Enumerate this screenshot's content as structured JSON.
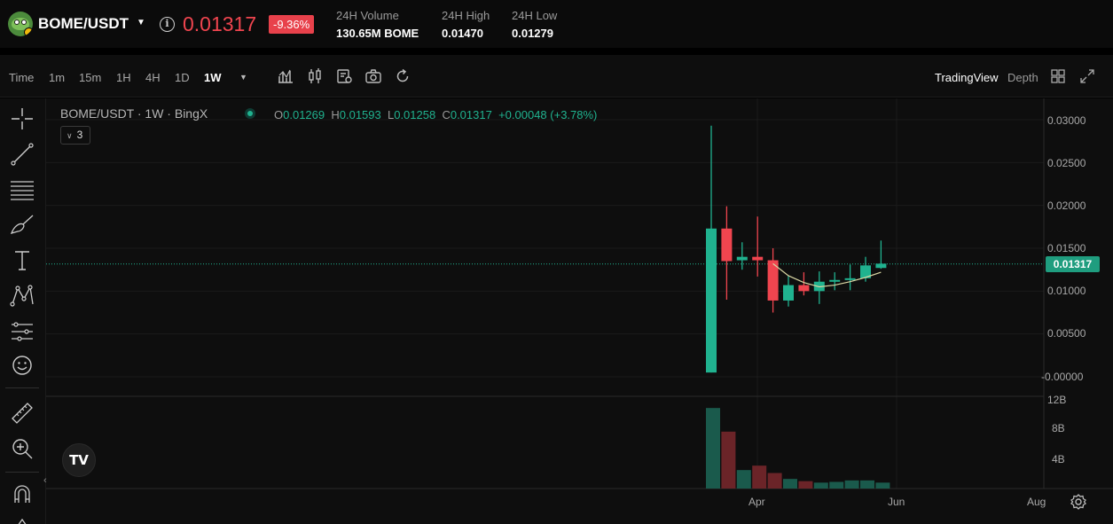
{
  "ticker": {
    "pair": "BOME/USDT",
    "price": "0.01317",
    "change": "-9.36%",
    "stats": [
      {
        "label": "24H Volume",
        "value": "130.65M BOME"
      },
      {
        "label": "24H High",
        "value": "0.01470"
      },
      {
        "label": "24H Low",
        "value": "0.01279"
      }
    ],
    "colors": {
      "down": "#f0454f",
      "up": "#20b28f"
    }
  },
  "toolbar": {
    "time_label": "Time",
    "timeframes": [
      "1m",
      "15m",
      "1H",
      "4H",
      "1D",
      "1W"
    ],
    "active_timeframe": "1W",
    "views": [
      "TradingView",
      "Depth"
    ],
    "active_view": "TradingView",
    "icons": [
      "indicators-icon",
      "candle-type-icon",
      "settings-icon",
      "camera-icon",
      "refresh-icon"
    ]
  },
  "left_tools": [
    "crosshair-icon",
    "trend-line-icon",
    "fib-lines-icon",
    "brush-icon",
    "text-icon",
    "pattern-icon",
    "measure-lines-icon",
    "emoji-icon",
    "ruler-icon",
    "zoom-in-icon",
    "magnet-icon"
  ],
  "legend": {
    "title": "BOME/USDT · 1W · BingX",
    "o_label": "O",
    "o": "0.01269",
    "h_label": "H",
    "h": "0.01593",
    "l_label": "L",
    "l": "0.01258",
    "c_label": "C",
    "c": "0.01317",
    "change": "+0.00048 (+3.78%)",
    "indicators_count": "3"
  },
  "logo_text": "TV",
  "current_price_tag": "0.01317",
  "chart_data": {
    "type": "candlestick",
    "interval": "1W",
    "y_ticks": [
      "0.03000",
      "0.02500",
      "0.02000",
      "0.01500",
      "0.01000",
      "0.00500",
      "-0.00000"
    ],
    "ylim": [
      0,
      0.03
    ],
    "x_ticks": [
      "Apr",
      "Jun",
      "Aug"
    ],
    "volume_ticks": [
      "12B",
      "8B",
      "4B"
    ],
    "volume_ylim": [
      0,
      12
    ],
    "candles": [
      {
        "o": 0.0005,
        "h": 0.0293,
        "l": 0.0005,
        "c": 0.0173,
        "v": 10.9
      },
      {
        "o": 0.0173,
        "h": 0.0199,
        "l": 0.009,
        "c": 0.0135,
        "v": 7.7
      },
      {
        "o": 0.0136,
        "h": 0.0157,
        "l": 0.0125,
        "c": 0.014,
        "v": 2.5
      },
      {
        "o": 0.014,
        "h": 0.0187,
        "l": 0.0117,
        "c": 0.0136,
        "v": 3.1
      },
      {
        "o": 0.0136,
        "h": 0.015,
        "l": 0.0075,
        "c": 0.0089,
        "v": 2.1
      },
      {
        "o": 0.0089,
        "h": 0.0118,
        "l": 0.0082,
        "c": 0.0107,
        "v": 1.3
      },
      {
        "o": 0.0107,
        "h": 0.0122,
        "l": 0.0095,
        "c": 0.01,
        "v": 1.0
      },
      {
        "o": 0.01,
        "h": 0.0123,
        "l": 0.0085,
        "c": 0.0111,
        "v": 0.8
      },
      {
        "o": 0.0111,
        "h": 0.0122,
        "l": 0.0101,
        "c": 0.0113,
        "v": 0.9
      },
      {
        "o": 0.0113,
        "h": 0.0131,
        "l": 0.0101,
        "c": 0.0115,
        "v": 1.1
      },
      {
        "o": 0.0115,
        "h": 0.014,
        "l": 0.0111,
        "c": 0.013,
        "v": 1.1
      },
      {
        "o": 0.0127,
        "h": 0.0159,
        "l": 0.0126,
        "c": 0.0132,
        "v": 0.8
      }
    ],
    "ma_line": [
      null,
      null,
      null,
      null,
      0.0132,
      0.0118,
      0.011,
      0.0105,
      0.0107,
      0.0111,
      0.0116,
      0.0122
    ],
    "current_price": 0.01317
  }
}
